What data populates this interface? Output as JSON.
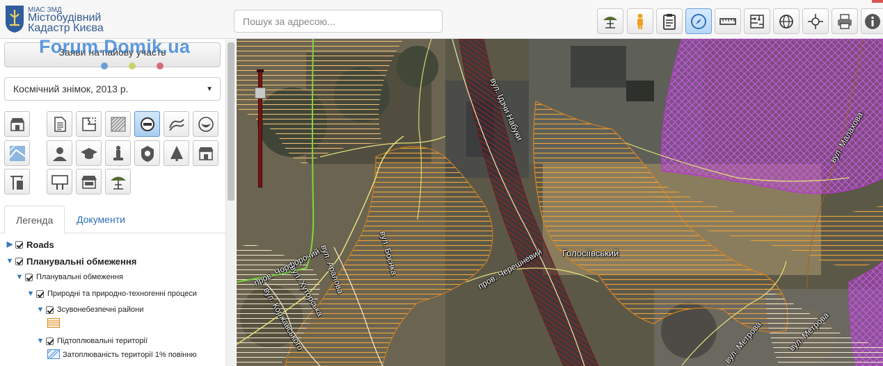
{
  "header": {
    "org_small": "МІАС ЗМД",
    "title_line1": "Містобудівний",
    "title_line2": "Кадастр Києва",
    "search_placeholder": "Пошук за адресою...",
    "toolbar_icons": [
      "umbrella-table-icon",
      "person-icon",
      "clipboard-icon",
      "compass-icon",
      "ruler-icon",
      "measure-area-icon",
      "globe-pin-icon",
      "crosshair-icon",
      "printer-icon",
      "info-icon"
    ],
    "active_toolbar_icon": "compass-icon"
  },
  "sidebar": {
    "watermark": "Forum.Domik.ua",
    "apply_button": "Заяви на пайову участь",
    "dot_colors": [
      "#6a9fd6",
      "#c9d36a",
      "#d96a7e"
    ],
    "layer_select": "Космічний знімок, 2013 р.",
    "category_icons": [
      "shop-icon",
      "document-icon",
      "puzzle-icon",
      "hatched-map-icon",
      "no-entry-icon",
      "waves-icon",
      "drop-icon",
      "map-icon",
      "person-icon",
      "graduation-cap-icon",
      "monument-icon",
      "police-badge-icon",
      "tree-icon",
      "store-icon",
      "crane-building-icon",
      "billboard-icon",
      "kiosk-icon",
      "umbrella-table-icon"
    ],
    "active_category_icon": "no-entry-icon",
    "tabs": {
      "legend": "Легенда",
      "documents": "Документи"
    },
    "tree": [
      {
        "label": "Roads",
        "level": 0,
        "bold": true,
        "chevron": "right",
        "checked": true
      },
      {
        "label": "Планувальні обмеження",
        "level": 0,
        "bold": true,
        "chevron": "down",
        "checked": true
      },
      {
        "label": "Планувальні обмеження",
        "level": 1,
        "chevron": "down",
        "checked": true
      },
      {
        "label": "Природні та природно-техногенні процеси",
        "level": 2,
        "chevron": "down",
        "checked": true
      },
      {
        "label": "Зсувонебезпечні райони",
        "level": 3,
        "chevron": "down",
        "checked": true
      },
      {
        "label": "Підтоплювальні території",
        "level": 3,
        "chevron": "down",
        "checked": true
      },
      {
        "label": "Затоплюваність території 1% повінню",
        "level": 4
      }
    ],
    "swatch_colors": {
      "landslide": "#e08a1e",
      "flood": "#4a8fd6"
    }
  },
  "map": {
    "district_label": "Голосіївський",
    "streets": [
      "пров. Чорфорочий",
      "вул. Хуторська",
      "вул. Аралова",
      "вул. Боєнка",
      "вул. Коржавського",
      "пров. Черешневий",
      "вул. Ідзчи Набуки",
      "вул. Метрова",
      "вул. Метрова",
      "вул. Малахова"
    ],
    "overlay_colors": {
      "landslide_hatch": "#e8a13a",
      "restriction_zone": "#b43cc8",
      "railway": "#6b2020",
      "road": "#e8e27a",
      "green_line": "#7fd640"
    }
  }
}
